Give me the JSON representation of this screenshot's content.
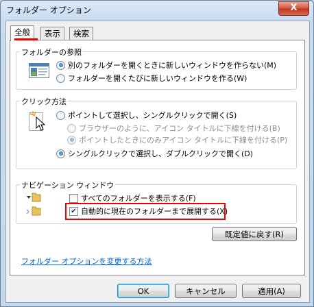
{
  "window": {
    "title": "フォルダー オプション",
    "close_glyph": "X"
  },
  "tabs": [
    {
      "label": "全般"
    },
    {
      "label": "表示"
    },
    {
      "label": "検索"
    }
  ],
  "browse_folders": {
    "label": "フォルダーの参照",
    "options": [
      {
        "label": "別のフォルダーを開くときに新しいウィンドウを作らない(M)",
        "selected": true
      },
      {
        "label": "フォルダーを開くたびに新しいウィンドウを作る(W)",
        "selected": false
      }
    ]
  },
  "click_items": {
    "label": "クリック方法",
    "options": [
      {
        "label": "ポイントして選択し、シングルクリックで開く(S)",
        "selected": false
      },
      {
        "label": "ブラウザーのように、アイコン タイトルに下線を付ける(B)",
        "selected": false,
        "disabled": true
      },
      {
        "label": "ポイントしたときにのみアイコン タイトルに下線を付ける(P)",
        "selected": true,
        "disabled": true
      },
      {
        "label": "シングルクリックで選択し、ダブルクリックで開く(D)",
        "selected": true
      }
    ]
  },
  "navigation_pane": {
    "label": "ナビゲーション ウィンドウ",
    "show_all_folders": {
      "label": "すべてのフォルダーを表示する(F)",
      "checked": false
    },
    "auto_expand": {
      "label": "自動的に現在のフォルダーまで展開する(X)",
      "checked": true
    }
  },
  "restore_defaults_label": "既定値に戻す(R)",
  "help_link": "フォルダー オプションを変更する方法",
  "buttons": {
    "ok": "OK",
    "cancel": "キャンセル",
    "apply": "適用(A)"
  },
  "colors": {
    "highlight": "#ee0000",
    "link": "#0066cc"
  }
}
